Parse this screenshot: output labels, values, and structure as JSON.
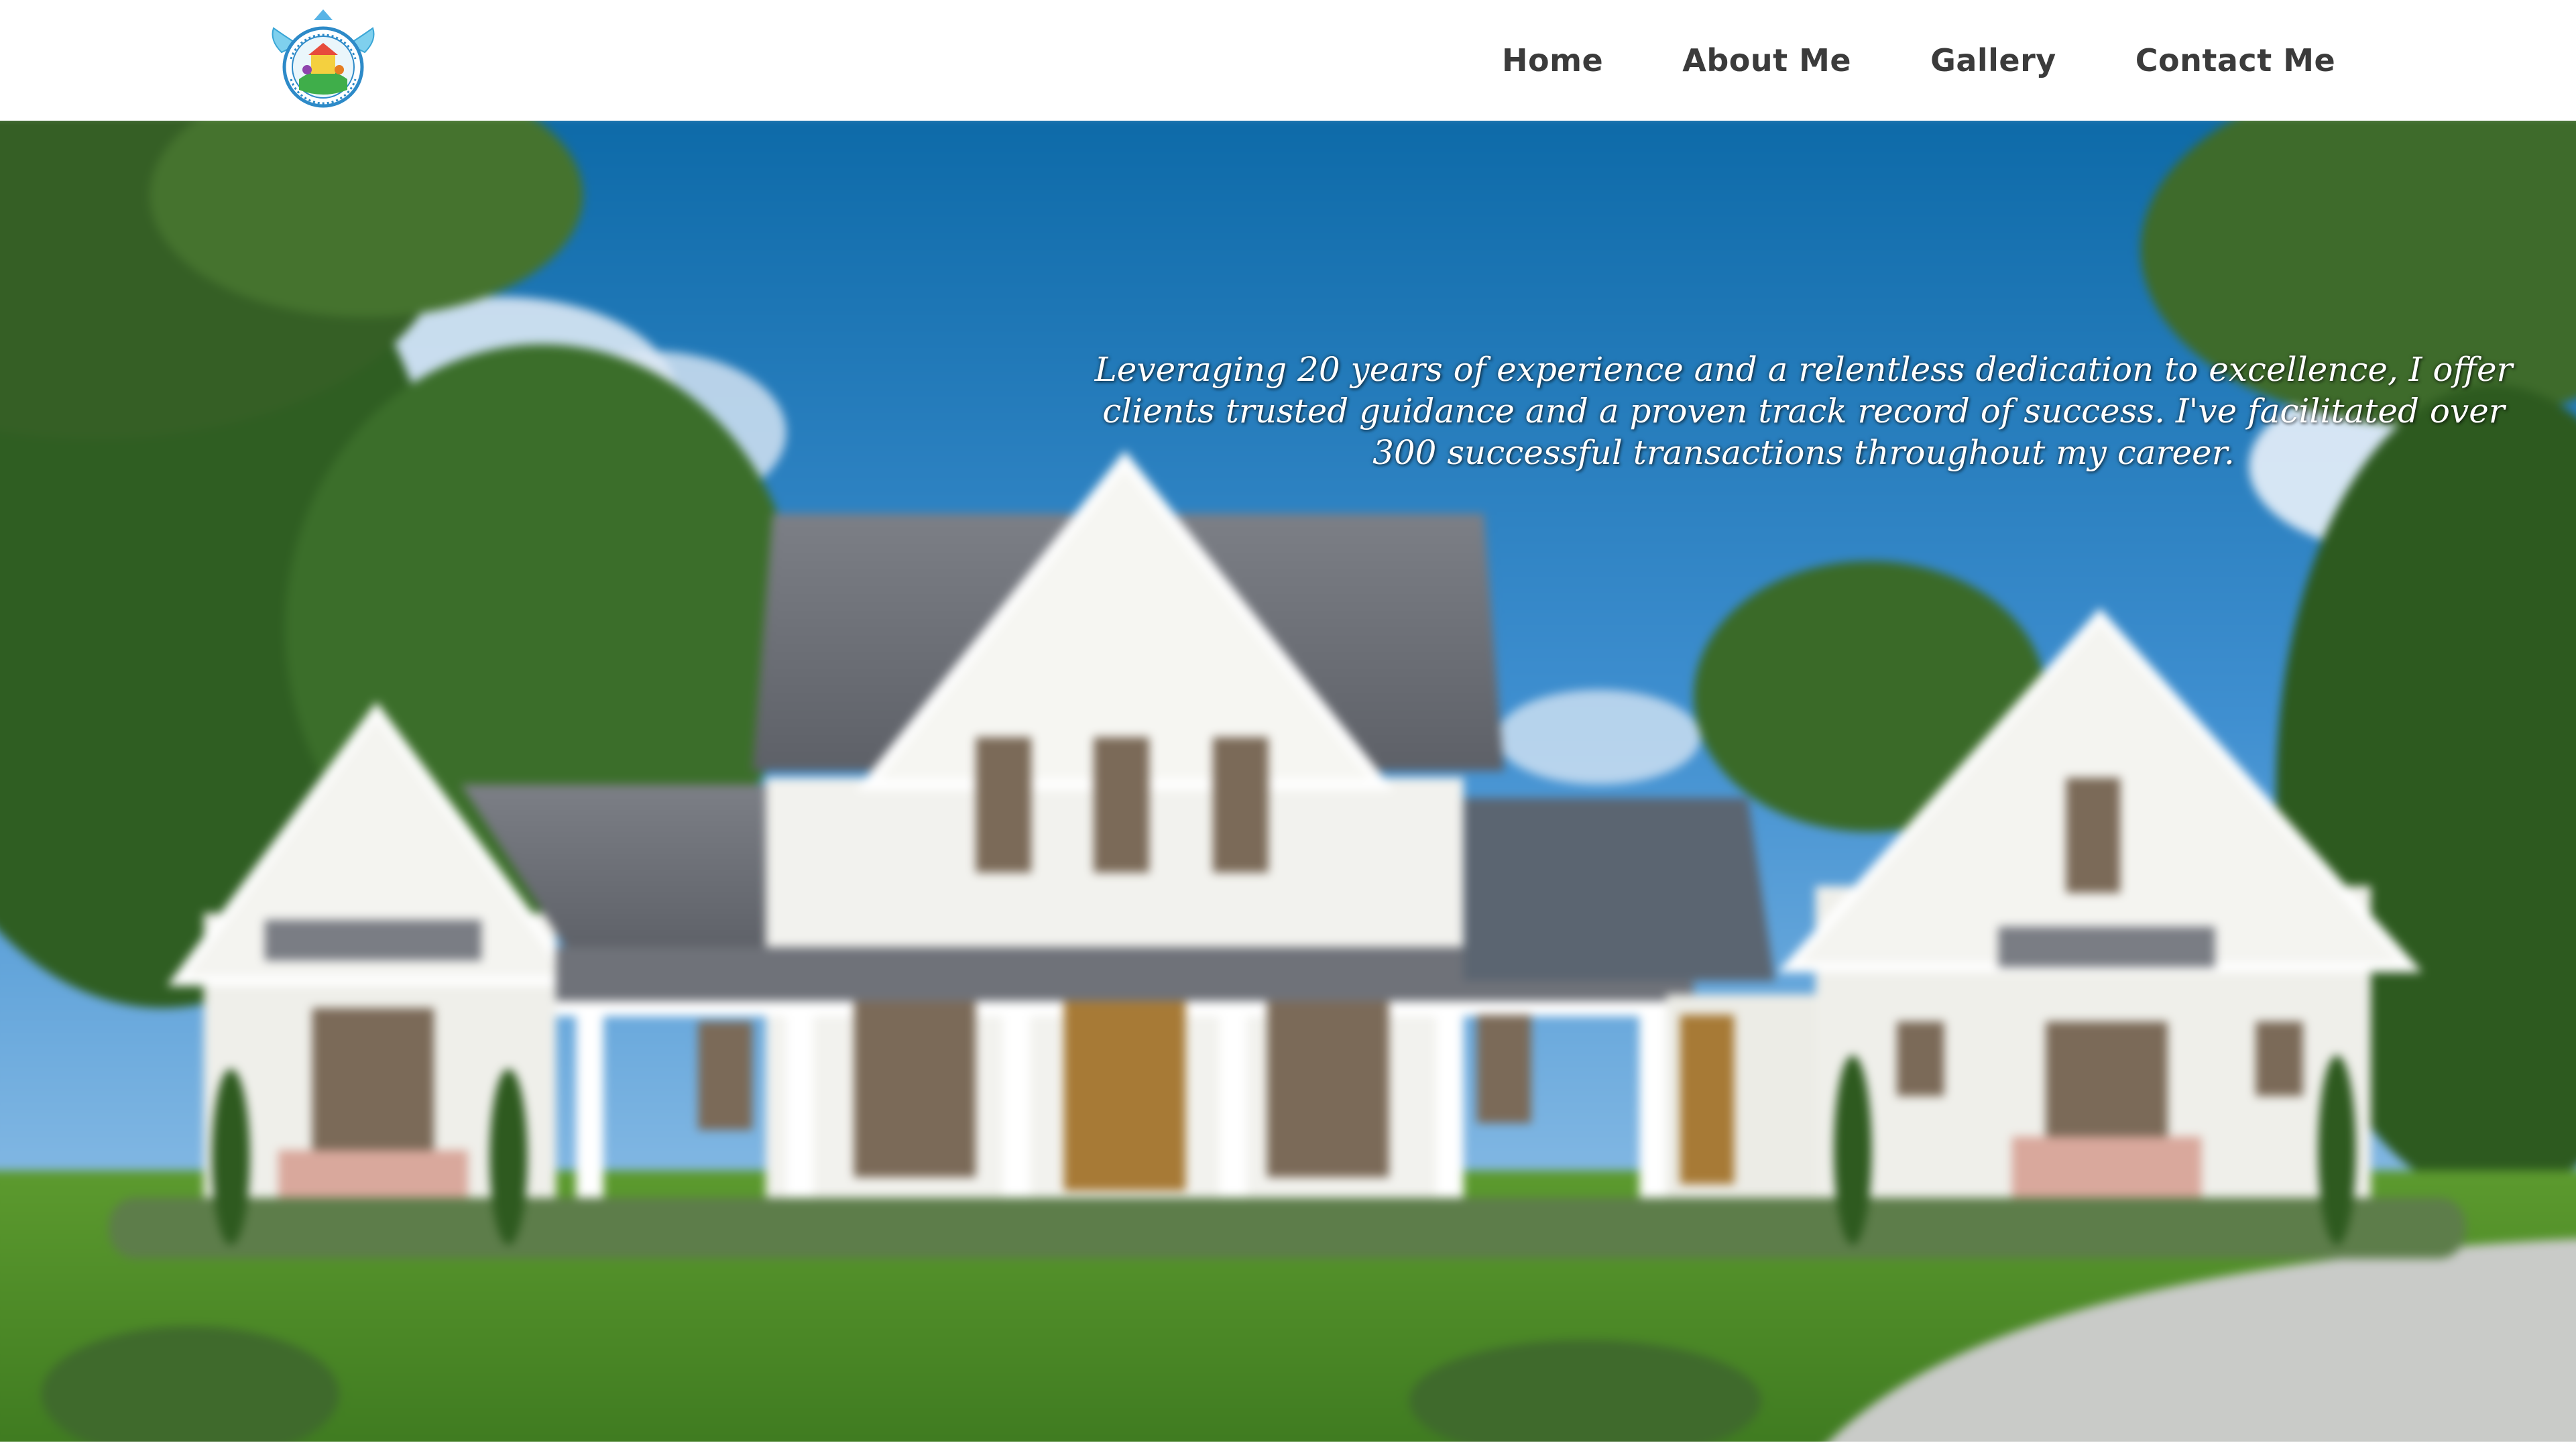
{
  "nav": {
    "items": [
      {
        "label": "Home"
      },
      {
        "label": "About Me"
      },
      {
        "label": "Gallery"
      },
      {
        "label": "Contact Me"
      }
    ]
  },
  "hero": {
    "tagline": "Leveraging 20 years of experience and a relentless dedication to excellence, I offer clients trusted guidance and a proven track record of success. I've facilitated over 300 successful transactions throughout my career."
  },
  "colors": {
    "header_bg": "#ffffff",
    "nav_text": "#3b3b3b",
    "quote_text": "#ffffff",
    "sky": "#2f7fc4",
    "siding": "#f2f2ee",
    "roof": "#6d7077",
    "lawn": "#4f8a2a"
  },
  "icons": {
    "logo": "logo-icon"
  }
}
